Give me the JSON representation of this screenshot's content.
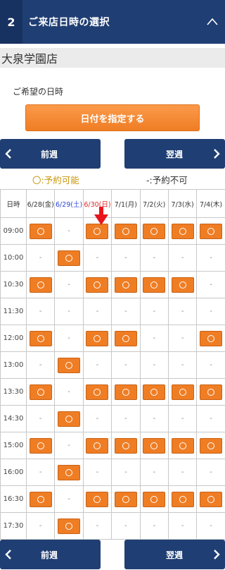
{
  "header": {
    "step": "2",
    "title": "ご来店日時の選択"
  },
  "store": {
    "name": "大泉学園店"
  },
  "preferred": {
    "label": "ご希望の日時",
    "button": "日付を指定する"
  },
  "nav": {
    "prev": "前週",
    "next": "翌週"
  },
  "legend": {
    "available": "〇:予約可能",
    "unavailable": "-:予約不可"
  },
  "table": {
    "corner": "日時",
    "days": [
      "6/28(金)",
      "6/29(土)",
      "6/30(日)",
      "7/1(月)",
      "7/2(火)",
      "7/3(水)",
      "7/4(木)"
    ],
    "na_mark": "-",
    "rows": [
      {
        "time": "09:00",
        "slots": [
          1,
          0,
          1,
          1,
          1,
          1,
          1
        ]
      },
      {
        "time": "10:00",
        "slots": [
          0,
          1,
          0,
          0,
          0,
          0,
          0
        ]
      },
      {
        "time": "10:30",
        "slots": [
          1,
          0,
          1,
          1,
          1,
          1,
          0
        ]
      },
      {
        "time": "11:30",
        "slots": [
          0,
          0,
          0,
          0,
          0,
          0,
          0
        ]
      },
      {
        "time": "12:00",
        "slots": [
          1,
          0,
          1,
          1,
          0,
          0,
          1
        ]
      },
      {
        "time": "13:00",
        "slots": [
          0,
          1,
          0,
          0,
          0,
          0,
          0
        ]
      },
      {
        "time": "13:30",
        "slots": [
          1,
          0,
          1,
          1,
          1,
          1,
          1
        ]
      },
      {
        "time": "14:30",
        "slots": [
          0,
          1,
          0,
          0,
          0,
          0,
          0
        ]
      },
      {
        "time": "15:00",
        "slots": [
          1,
          0,
          1,
          1,
          1,
          1,
          1
        ]
      },
      {
        "time": "16:00",
        "slots": [
          0,
          1,
          0,
          0,
          0,
          0,
          0
        ]
      },
      {
        "time": "16:30",
        "slots": [
          1,
          0,
          1,
          1,
          1,
          1,
          1
        ]
      },
      {
        "time": "17:30",
        "slots": [
          0,
          1,
          0,
          0,
          0,
          0,
          0
        ]
      }
    ]
  },
  "colors": {
    "navy": "#1f3e73",
    "orange": "#ef7d24",
    "saturday": "#2b45d6",
    "sunday": "#e02626",
    "pointer": "#e8141b"
  },
  "icons": {
    "collapse": "chevron-up-icon",
    "prev": "chevron-left-icon",
    "next": "chevron-right-icon",
    "pointer": "red-arrow-icon"
  }
}
